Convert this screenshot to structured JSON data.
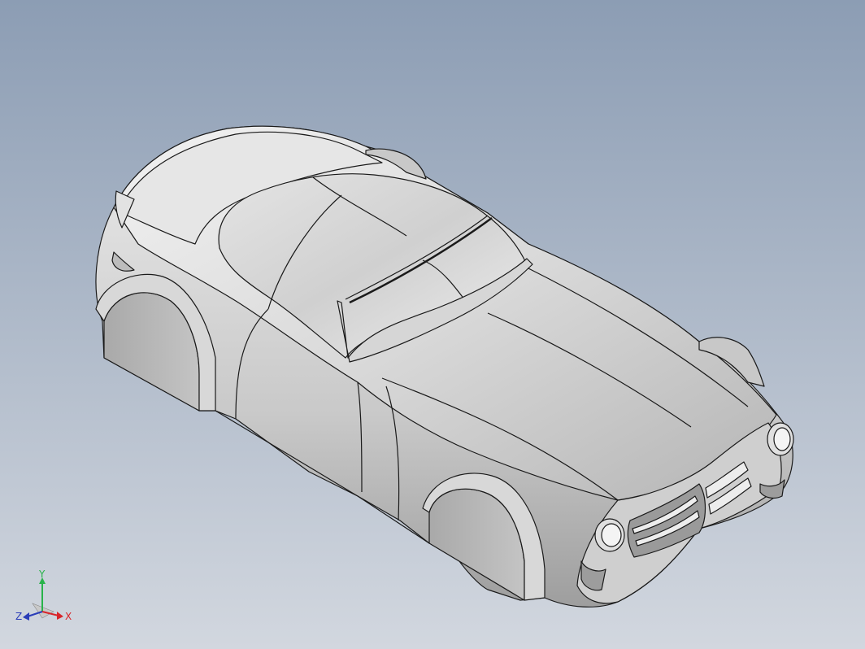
{
  "viewport": {
    "background_top": "#8c9db4",
    "background_bottom": "#d2d7df",
    "model": "car-body-surface-model"
  },
  "triad": {
    "x_label": "X",
    "y_label": "Y",
    "z_label": "Z",
    "x_color": "#d8252a",
    "y_color": "#28b34a",
    "z_color": "#2a3db8"
  }
}
